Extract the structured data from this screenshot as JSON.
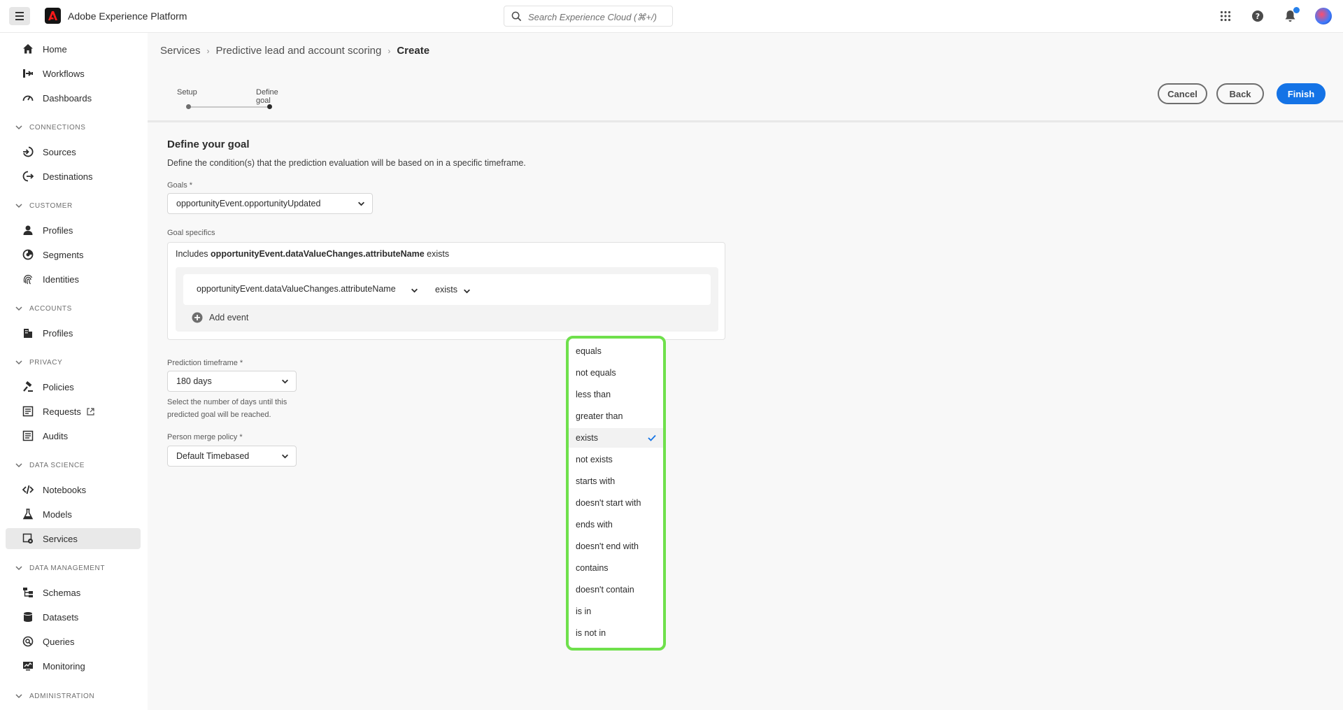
{
  "header": {
    "app_title": "Adobe Experience Platform",
    "search_placeholder": "Search Experience Cloud (⌘+/)"
  },
  "sidebar": {
    "items": [
      {
        "id": "home",
        "label": "Home"
      },
      {
        "id": "workflows",
        "label": "Workflows"
      },
      {
        "id": "dashboards",
        "label": "Dashboards"
      },
      {
        "id": "sources",
        "label": "Sources"
      },
      {
        "id": "destinations",
        "label": "Destinations"
      },
      {
        "id": "profiles",
        "label": "Profiles"
      },
      {
        "id": "segments",
        "label": "Segments"
      },
      {
        "id": "identities",
        "label": "Identities"
      },
      {
        "id": "account-profiles",
        "label": "Profiles"
      },
      {
        "id": "policies",
        "label": "Policies"
      },
      {
        "id": "requests",
        "label": "Requests"
      },
      {
        "id": "audits",
        "label": "Audits"
      },
      {
        "id": "notebooks",
        "label": "Notebooks"
      },
      {
        "id": "models",
        "label": "Models"
      },
      {
        "id": "services",
        "label": "Services"
      },
      {
        "id": "schemas",
        "label": "Schemas"
      },
      {
        "id": "datasets",
        "label": "Datasets"
      },
      {
        "id": "queries",
        "label": "Queries"
      },
      {
        "id": "monitoring",
        "label": "Monitoring"
      }
    ],
    "sections": {
      "connections": "CONNECTIONS",
      "customer": "CUSTOMER",
      "accounts": "ACCOUNTS",
      "privacy": "PRIVACY",
      "data_science": "DATA SCIENCE",
      "data_management": "DATA MANAGEMENT",
      "administration": "ADMINISTRATION"
    },
    "active": "services"
  },
  "breadcrumb": {
    "items": [
      "Services",
      "Predictive lead and account scoring"
    ],
    "current": "Create"
  },
  "steps": {
    "setup": "Setup",
    "define_goal": "Define goal"
  },
  "actions": {
    "cancel": "Cancel",
    "back": "Back",
    "finish": "Finish"
  },
  "goal": {
    "title": "Define your goal",
    "description": "Define the condition(s) that the prediction evaluation will be based on in a specific timeframe.",
    "goals_label": "Goals *",
    "goals_value": "opportunityEvent.opportunityUpdated",
    "specifics_label": "Goal specifics",
    "includes_prefix": "Includes",
    "includes_field": "opportunityEvent.dataValueChanges.attributeName",
    "includes_suffix": "exists",
    "event_field": "opportunityEvent.dataValueChanges.attributeName",
    "operator": "exists",
    "add_event": "Add event",
    "timeframe_label": "Prediction timeframe *",
    "timeframe_value": "180 days",
    "timeframe_help": "Select the number of days until this predicted goal will be reached.",
    "merge_label": "Person merge policy *",
    "merge_value": "Default Timebased"
  },
  "operator_options": {
    "items": [
      "equals",
      "not equals",
      "less than",
      "greater than",
      "exists",
      "not exists",
      "starts with",
      "doesn't start with",
      "ends with",
      "doesn't end with",
      "contains",
      "doesn't contain",
      "is in",
      "is not in"
    ],
    "selected": "exists"
  },
  "colors": {
    "accent": "#1473e6",
    "highlight": "#6fe04c"
  }
}
